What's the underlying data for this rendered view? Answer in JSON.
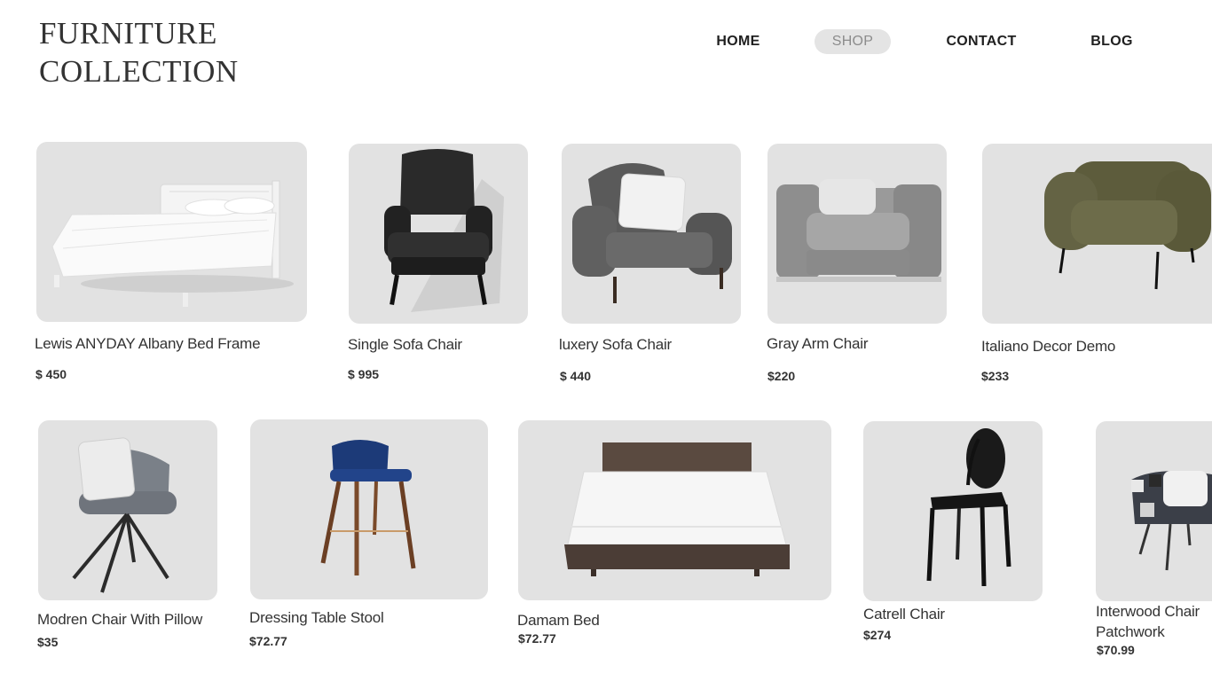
{
  "brand": {
    "line1": "FURNITURE",
    "line2": "COLLECTION"
  },
  "nav": [
    {
      "label": "HOME",
      "active": false
    },
    {
      "label": "SHOP",
      "active": true
    },
    {
      "label": "CONTACT",
      "active": false
    },
    {
      "label": "BLOG",
      "active": false
    }
  ],
  "products": [
    {
      "name": "Lewis ANYDAY Albany Bed Frame",
      "price": "$ 450",
      "image": "white-bed-frame"
    },
    {
      "name": "Single Sofa Chair",
      "price": "$ 995",
      "image": "black-wingback-chair"
    },
    {
      "name": "luxery Sofa Chair",
      "price": "$ 440",
      "image": "gray-slipcover-armchair"
    },
    {
      "name": "Gray Arm Chair",
      "price": "$220",
      "image": "gray-arm-chair"
    },
    {
      "name": "Italiano Decor Demo",
      "price": "$233",
      "image": "olive-armchair"
    },
    {
      "name": "Modren Chair With Pillow",
      "price": "$35",
      "image": "gray-swivel-chair-with-pillow"
    },
    {
      "name": "Dressing Table Stool",
      "price": "$72.77",
      "image": "blue-bar-stool"
    },
    {
      "name": "Damam Bed",
      "price": "$72.77",
      "image": "wooden-platform-bed"
    },
    {
      "name": "Catrell Chair",
      "price": "$274",
      "image": "black-ghost-chair"
    },
    {
      "name": "Interwood Chair",
      "name_line2": "Patchwork",
      "price": "$70.99",
      "image": "patchwork-chair"
    }
  ]
}
